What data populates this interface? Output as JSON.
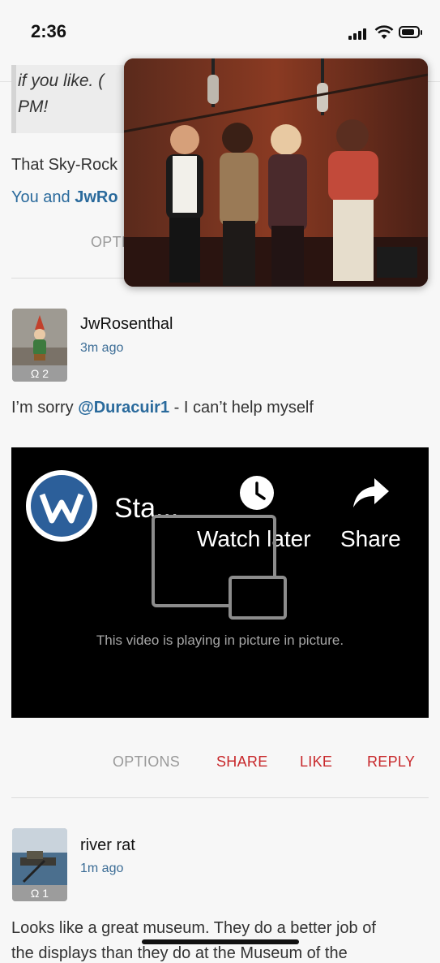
{
  "status_bar": {
    "time": "2:36",
    "signal_icon": "signal-bars-icon",
    "wifi_icon": "wifi-icon",
    "battery_icon": "battery-icon"
  },
  "prev_post": {
    "quote_line1": "if you like. (",
    "quote_line2": "PM!",
    "text": "That Sky-Rock",
    "likes_prefix": "You and ",
    "likes_user": "JwRo",
    "options_label": "OPTI"
  },
  "pip_window": {
    "description_icon": "pip-video-frame"
  },
  "post1": {
    "username": "JwRosenthal",
    "time_ago": "3m ago",
    "rank_badge": "Ω 2",
    "text_prefix": "I’m sorry ",
    "mention": "@Duracuir1",
    "text_suffix": " - I can’t help myself",
    "video": {
      "title": "Sta...",
      "watch_later": "Watch later",
      "share": "Share",
      "pip_message": "This video is playing in picture in picture."
    },
    "actions": {
      "options": "OPTIONS",
      "share": "SHARE",
      "like": "LIKE",
      "reply": "REPLY"
    }
  },
  "post2": {
    "username": "river rat",
    "time_ago": "1m ago",
    "rank_badge": "Ω 1",
    "text_line1": "Looks like a great museum. They do a better job of",
    "text_line2": "the displays than they do at the Museum of the"
  },
  "colors": {
    "link": "#2a6a9c",
    "action_red": "#c8282b",
    "action_gray": "#9a9a9a",
    "background": "#f7f7f7"
  }
}
